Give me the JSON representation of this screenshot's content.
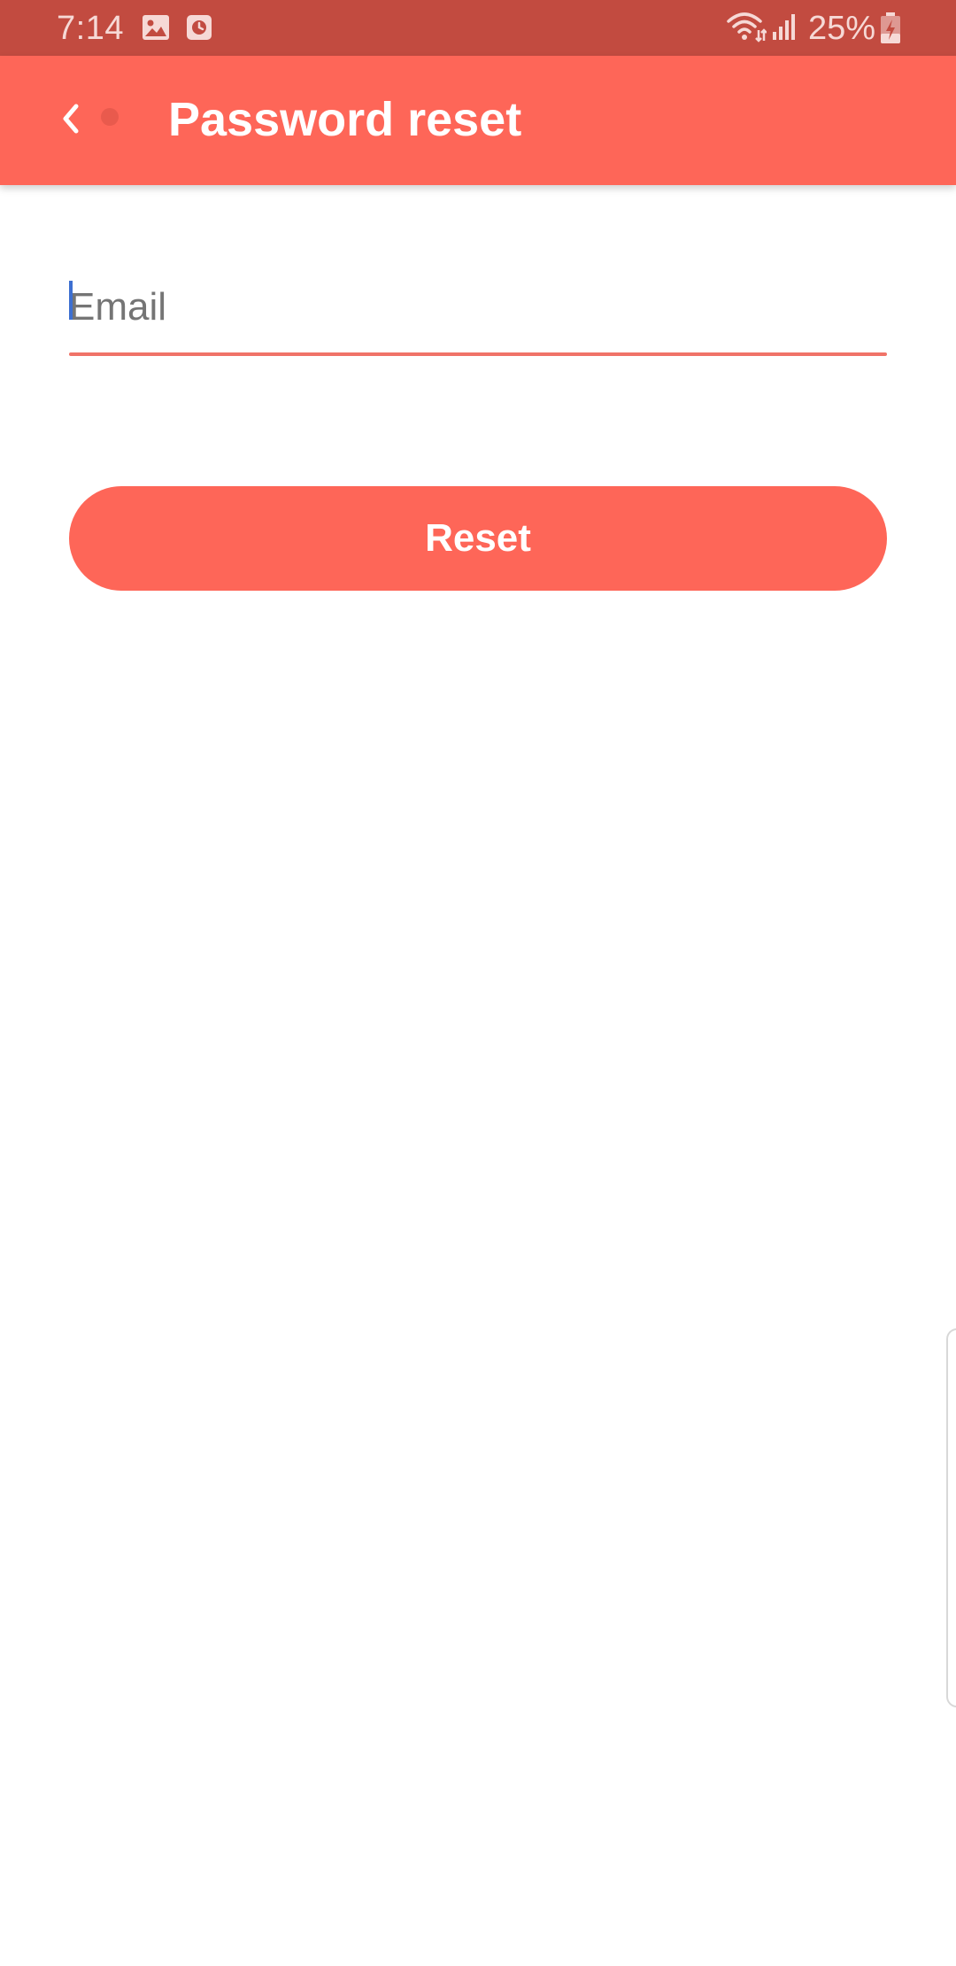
{
  "status_bar": {
    "time": "7:14",
    "battery": "25%",
    "icons": [
      "image-icon",
      "clock-app-icon",
      "wifi-icon",
      "signal-icon",
      "battery-charging-icon"
    ]
  },
  "app_bar": {
    "title": "Password reset",
    "back_icon": "chevron-left-icon"
  },
  "form": {
    "email_placeholder": "Email",
    "email_value": "",
    "reset_label": "Reset"
  },
  "colors": {
    "status_bar": "#c24b40",
    "primary": "#fe6658",
    "field_underline": "#f07368",
    "caret": "#3d6fd1"
  }
}
